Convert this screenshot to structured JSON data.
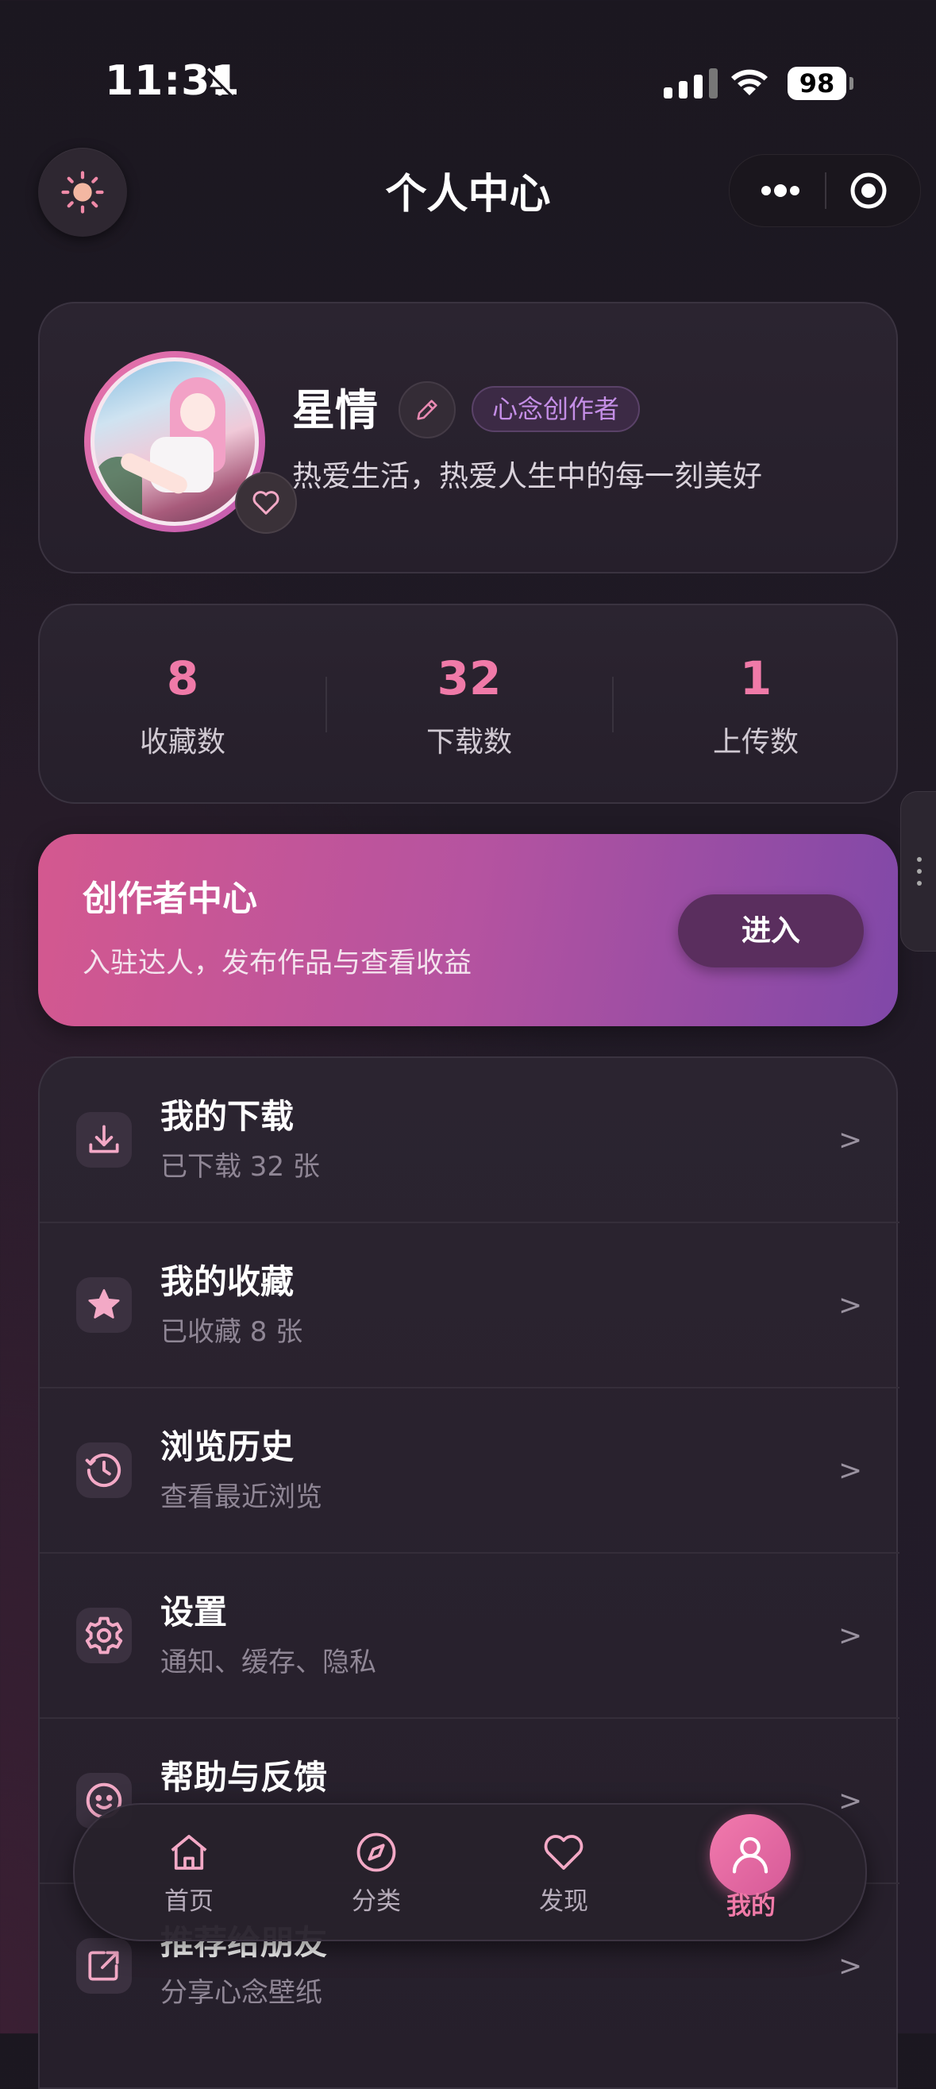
{
  "status_bar": {
    "time": "11:31",
    "battery": "98"
  },
  "header": {
    "title": "个人中心"
  },
  "profile": {
    "username": "星情",
    "badge": "心念创作者",
    "bio": "热爱生活，热爱人生中的每一刻美好"
  },
  "stats": [
    {
      "value": "8",
      "label": "收藏数"
    },
    {
      "value": "32",
      "label": "下载数"
    },
    {
      "value": "1",
      "label": "上传数"
    }
  ],
  "creator": {
    "title": "创作者中心",
    "subtitle": "入驻达人，发布作品与查看收益",
    "button": "进入"
  },
  "menu": [
    {
      "title": "我的下载",
      "subtitle": "已下载 32 张",
      "icon": "download-icon"
    },
    {
      "title": "我的收藏",
      "subtitle": "已收藏 8 张",
      "icon": "star-icon"
    },
    {
      "title": "浏览历史",
      "subtitle": "查看最近浏览",
      "icon": "history-icon"
    },
    {
      "title": "设置",
      "subtitle": "通知、缓存、隐私",
      "icon": "gear-icon"
    },
    {
      "title": "帮助与反馈",
      "subtitle": "",
      "icon": "feedback-icon"
    },
    {
      "title": "推荐给朋友",
      "subtitle": "分享心念壁纸",
      "icon": "share-icon"
    }
  ],
  "menu_arrow": ">",
  "tabbar": [
    {
      "label": "首页",
      "icon": "home-icon"
    },
    {
      "label": "分类",
      "icon": "compass-icon"
    },
    {
      "label": "发现",
      "icon": "heart-icon"
    },
    {
      "label": "我的",
      "icon": "user-icon",
      "active": true
    }
  ],
  "colors": {
    "accent": "#f07aa8",
    "badge": "#c48ee6",
    "background": "#1e1922"
  }
}
